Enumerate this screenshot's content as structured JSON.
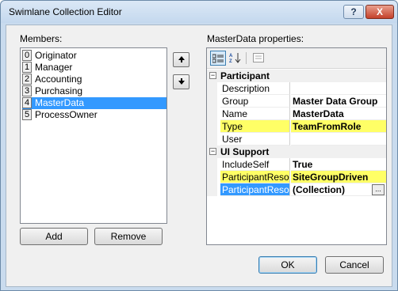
{
  "window": {
    "title": "Swimlane Collection Editor",
    "help_label": "?",
    "close_label": "X"
  },
  "members": {
    "label": "Members:",
    "items": [
      {
        "index": "0",
        "name": "Originator",
        "selected": false
      },
      {
        "index": "1",
        "name": "Manager",
        "selected": false
      },
      {
        "index": "2",
        "name": "Accounting",
        "selected": false
      },
      {
        "index": "3",
        "name": "Purchasing",
        "selected": false
      },
      {
        "index": "4",
        "name": "MasterData",
        "selected": true
      },
      {
        "index": "5",
        "name": "ProcessOwner",
        "selected": false
      }
    ],
    "add_label": "Add",
    "remove_label": "Remove",
    "move_up_icon": "arrow-up",
    "move_down_icon": "arrow-down"
  },
  "properties": {
    "label": "MasterData properties:",
    "toolbar": {
      "categorized_icon": "categorized",
      "alphabetical_icon": "sort-az",
      "pages_icon": "property-pages"
    },
    "categories": [
      {
        "name": "Participant",
        "expander": "⊟",
        "rows": [
          {
            "name": "Description",
            "value": "",
            "highlight": false,
            "selected": false,
            "has_ellipsis": false
          },
          {
            "name": "Group",
            "value": "Master Data Group",
            "highlight": false,
            "selected": false,
            "has_ellipsis": false
          },
          {
            "name": "Name",
            "value": "MasterData",
            "highlight": false,
            "selected": false,
            "has_ellipsis": false
          },
          {
            "name": "Type",
            "value": "TeamFromRole",
            "highlight": true,
            "selected": false,
            "has_ellipsis": false
          },
          {
            "name": "User",
            "value": "",
            "highlight": false,
            "selected": false,
            "has_ellipsis": false
          }
        ]
      },
      {
        "name": "UI Support",
        "expander": "⊟",
        "rows": [
          {
            "name": "IncludeSelf",
            "value": "True",
            "highlight": false,
            "selected": false,
            "has_ellipsis": false
          },
          {
            "name": "ParticipantResolver",
            "value": "SiteGroupDriven",
            "highlight": true,
            "selected": false,
            "has_ellipsis": false
          },
          {
            "name": "ParticipantResolverData",
            "value": "(Collection)",
            "highlight": false,
            "selected": true,
            "has_ellipsis": true
          }
        ]
      }
    ],
    "ellipsis_label": "..."
  },
  "buttons": {
    "ok_label": "OK",
    "cancel_label": "Cancel"
  },
  "colors": {
    "highlight": "#ffff66",
    "selection": "#3399ff"
  }
}
